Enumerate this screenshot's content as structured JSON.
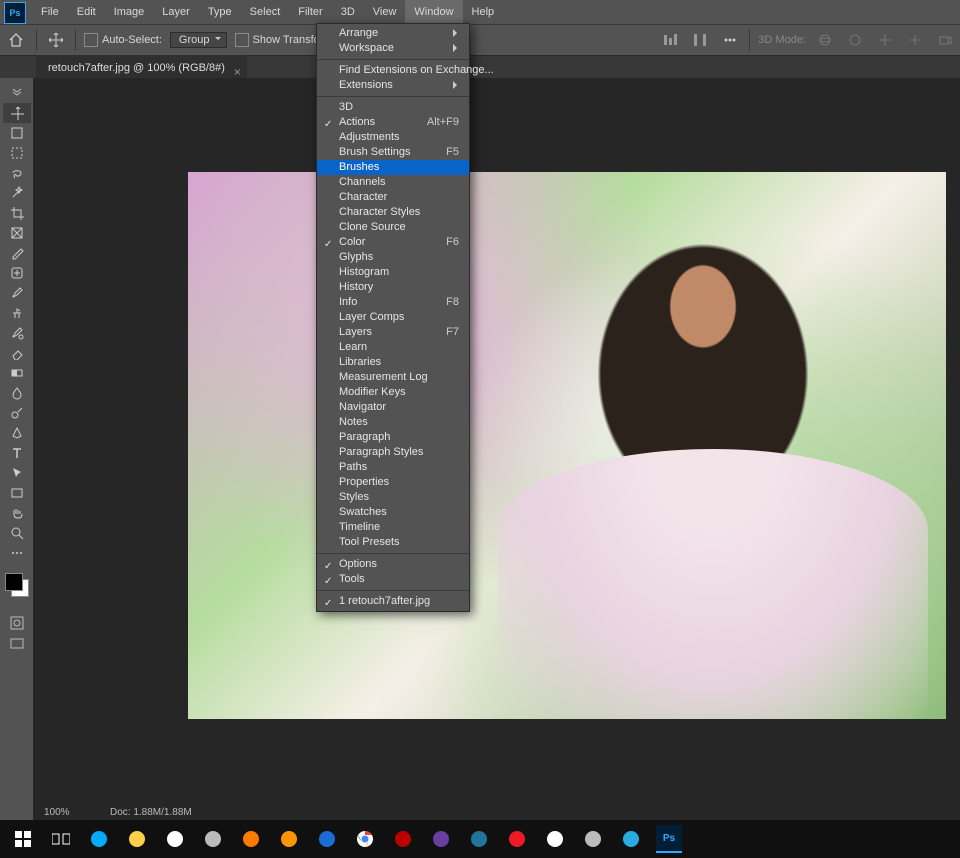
{
  "menubar": [
    "File",
    "Edit",
    "Image",
    "Layer",
    "Type",
    "Select",
    "Filter",
    "3D",
    "View",
    "Window",
    "Help"
  ],
  "menubar_active_index": 9,
  "optionsbar": {
    "auto_select": "Auto-Select:",
    "group": "Group",
    "show_transform": "Show Transform Controls",
    "mode_label": "3D Mode:"
  },
  "document_tab": {
    "title": "retouch7after.jpg @ 100% (RGB/8#)"
  },
  "statusbar": {
    "zoom": "100%",
    "doc": "Doc: 1.88M/1.88M"
  },
  "window_menu": {
    "groups": [
      [
        {
          "label": "Arrange",
          "submenu": true
        },
        {
          "label": "Workspace",
          "submenu": true
        }
      ],
      [
        {
          "label": "Find Extensions on Exchange..."
        },
        {
          "label": "Extensions",
          "submenu": true
        }
      ],
      [
        {
          "label": "3D"
        },
        {
          "label": "Actions",
          "checked": true,
          "shortcut": "Alt+F9"
        },
        {
          "label": "Adjustments"
        },
        {
          "label": "Brush Settings",
          "shortcut": "F5"
        },
        {
          "label": "Brushes",
          "highlight": true
        },
        {
          "label": "Channels"
        },
        {
          "label": "Character"
        },
        {
          "label": "Character Styles"
        },
        {
          "label": "Clone Source"
        },
        {
          "label": "Color",
          "checked": true,
          "shortcut": "F6"
        },
        {
          "label": "Glyphs"
        },
        {
          "label": "Histogram"
        },
        {
          "label": "History"
        },
        {
          "label": "Info",
          "shortcut": "F8"
        },
        {
          "label": "Layer Comps"
        },
        {
          "label": "Layers",
          "shortcut": "F7"
        },
        {
          "label": "Learn"
        },
        {
          "label": "Libraries"
        },
        {
          "label": "Measurement Log"
        },
        {
          "label": "Modifier Keys"
        },
        {
          "label": "Navigator"
        },
        {
          "label": "Notes"
        },
        {
          "label": "Paragraph"
        },
        {
          "label": "Paragraph Styles"
        },
        {
          "label": "Paths"
        },
        {
          "label": "Properties"
        },
        {
          "label": "Styles"
        },
        {
          "label": "Swatches"
        },
        {
          "label": "Timeline"
        },
        {
          "label": "Tool Presets"
        }
      ],
      [
        {
          "label": "Options",
          "checked": true
        },
        {
          "label": "Tools",
          "checked": true
        }
      ],
      [
        {
          "label": "1 retouch7after.jpg",
          "checked": true
        }
      ]
    ]
  },
  "tools": [
    "move",
    "artboard",
    "marquee",
    "lasso",
    "magic-wand",
    "crop",
    "frame",
    "eyedropper",
    "healing",
    "brush",
    "clone",
    "history-brush",
    "eraser",
    "gradient",
    "blur",
    "dodge",
    "pen",
    "text",
    "path-select",
    "rectangle",
    "hand",
    "zoom",
    "edit-toolbar"
  ],
  "taskbar": [
    "start",
    "task-view",
    "edge",
    "file-explorer",
    "store",
    "u-icon",
    "avast",
    "firefox",
    "malwarebytes",
    "chrome",
    "filezilla",
    "vs",
    "wp",
    "adobe",
    "mail",
    "x",
    "safari",
    "photoshop"
  ]
}
